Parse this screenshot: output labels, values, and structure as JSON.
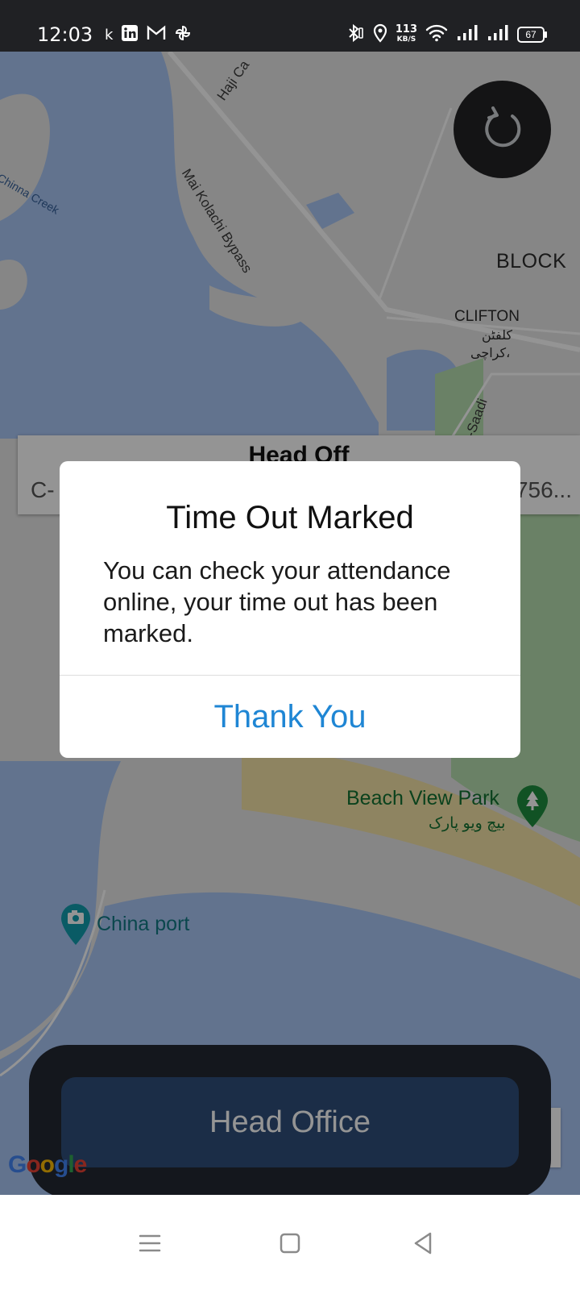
{
  "status_bar": {
    "time": "12:03",
    "left_icons": [
      "k-icon",
      "linkedin-icon",
      "gmail-icon",
      "pinwheel-icon"
    ],
    "net_speed_value": "113",
    "net_speed_unit": "KB/S",
    "battery_level": "67"
  },
  "map": {
    "road_labels": {
      "haji": "Haji Ca",
      "mai_kolachi": "Mai Kolachi Bypass",
      "saadi": "-Saadi"
    },
    "water_labels": {
      "chinna_creek": "Chinna Creek"
    },
    "area_labels": {
      "block": "BLOCK",
      "clifton": "CLIFTON",
      "clifton_urdu": "کلفٹن",
      "karachi_urdu": "کراچی،",
      "beach_view_park": "Beach View Park",
      "beach_view_park_urdu": "بیچ ویو پارک",
      "china_port": "China port"
    },
    "google_logo": "Google"
  },
  "info_card": {
    "title": "Head Off",
    "address": "C-",
    "coords": "756..."
  },
  "dialog": {
    "title": "Time Out Marked",
    "message": "You can check your attendance online, your time out has been marked.",
    "button": "Thank You"
  },
  "bottom_panel": {
    "button_label": "Head Office"
  },
  "colors": {
    "accent_blue": "#1f86d4",
    "panel_dark": "#232833",
    "panel_button": "#2f4f7a",
    "water": "#a9c6f5",
    "park": "#b7dfb0"
  }
}
